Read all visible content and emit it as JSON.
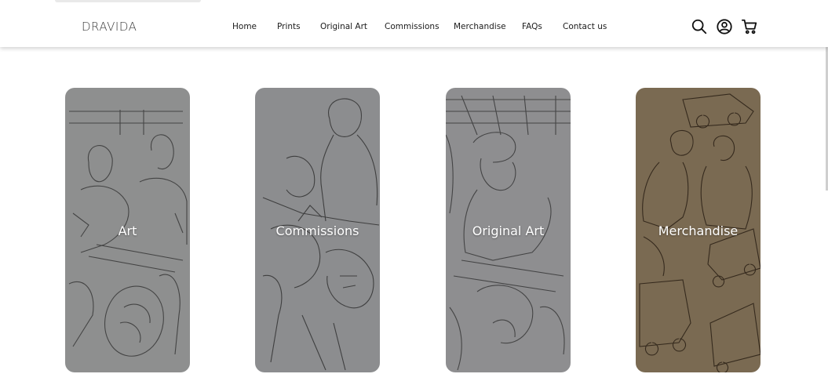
{
  "header": {
    "logo": "DRAVIDA",
    "nav": [
      {
        "label": "Home"
      },
      {
        "label": "Prints"
      },
      {
        "label": "Original Art"
      },
      {
        "label": "Commissions"
      },
      {
        "label": "Merchandise"
      },
      {
        "label": "FAQs"
      },
      {
        "label": "Contact us"
      }
    ],
    "icons": [
      "search-icon",
      "account-icon",
      "cart-icon"
    ]
  },
  "cards": [
    {
      "label": "Art",
      "background": "#8e8f8f"
    },
    {
      "label": "Commissions",
      "background": "#8c8d8f"
    },
    {
      "label": "Original Art",
      "background": "#8e8e90"
    },
    {
      "label": "Merchandise",
      "background": "#7a6a52"
    }
  ],
  "colors": {
    "header_bg": "#ffffff",
    "nav_text": "#1b1b1b",
    "card_label": "#ffffff",
    "sketch_line": "#2c2c2c"
  }
}
